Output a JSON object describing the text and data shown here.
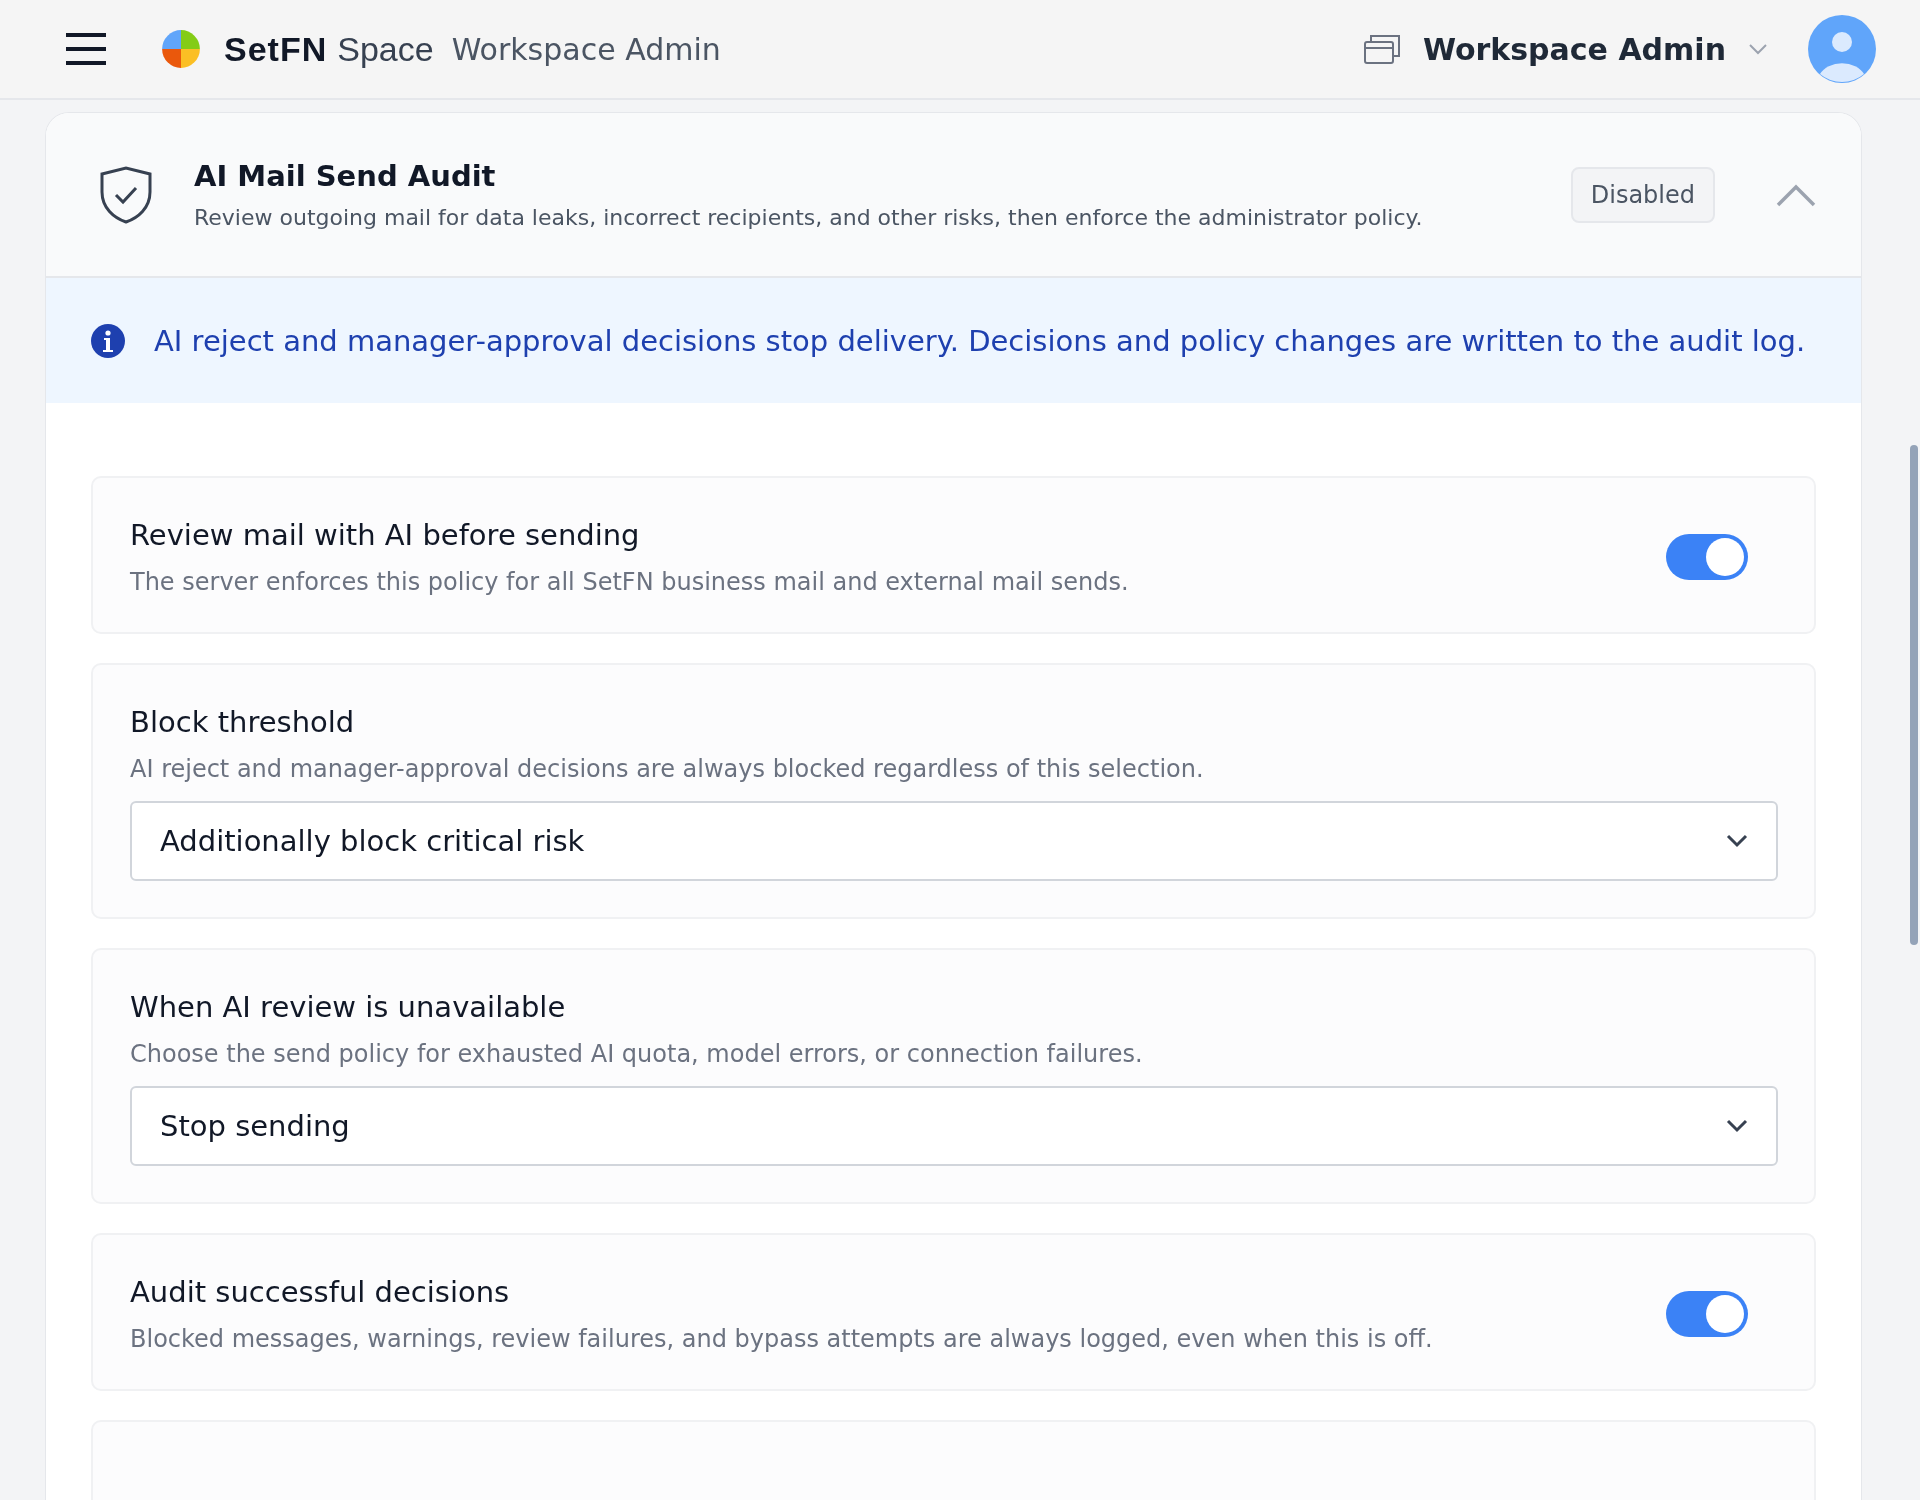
{
  "header": {
    "brand_primary": "SetFN",
    "brand_secondary": "Space",
    "section": "Workspace Admin",
    "workspace": "Workspace Admin"
  },
  "panel": {
    "title": "AI Mail Send Audit",
    "description": "Review outgoing mail for data leaks, incorrect recipients, and other risks, then enforce the administrator policy.",
    "status": "Disabled",
    "expanded": true
  },
  "notice": "AI reject and manager-approval decisions stop delivery. Decisions and policy changes are written to the audit log.",
  "settings": [
    {
      "kind": "toggle",
      "title": "Review mail with AI before sending",
      "description": "The server enforces this policy for all SetFN business mail and external mail sends.",
      "on": true
    },
    {
      "kind": "select",
      "title": "Block threshold",
      "description": "AI reject and manager-approval decisions are always blocked regardless of this selection.",
      "value": "Additionally block critical risk"
    },
    {
      "kind": "select",
      "title": "When AI review is unavailable",
      "description": "Choose the send policy for exhausted AI quota, model errors, or connection failures.",
      "value": "Stop sending"
    },
    {
      "kind": "toggle",
      "title": "Audit successful decisions",
      "description": "Blocked messages, warnings, review failures, and bypass attempts are always logged, even when this is off.",
      "on": true
    },
    {
      "kind": "partial"
    }
  ]
}
